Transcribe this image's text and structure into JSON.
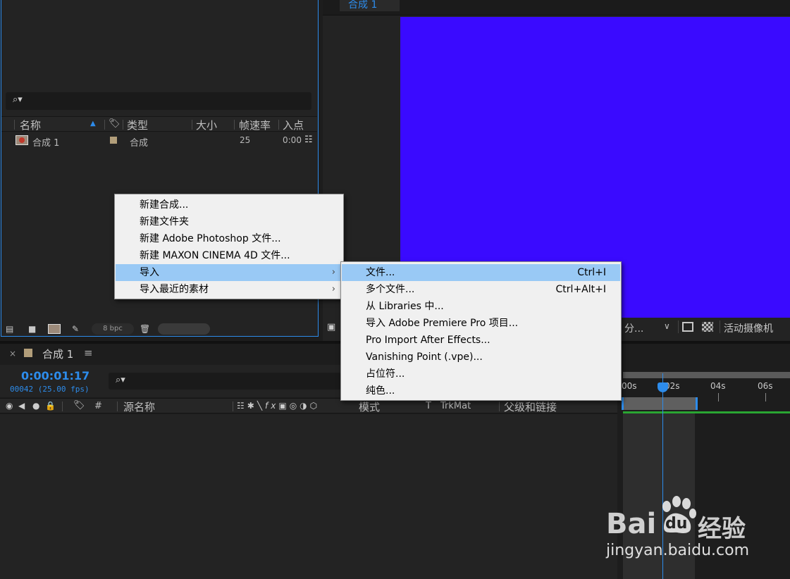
{
  "project_panel": {
    "columns": [
      "名称",
      "类型",
      "大小",
      "帧速率",
      "入点"
    ],
    "items": [
      {
        "name": "合成 1",
        "type": "合成",
        "fps": "25",
        "in_point": "0:00"
      }
    ],
    "bpc": "8 bpc"
  },
  "viewer": {
    "tab_label": "合成 1",
    "canvas_color": "#3a0aff",
    "resolution_label": "分...",
    "camera_label": "活动摄像机"
  },
  "context_menu": {
    "items": [
      {
        "label": "新建合成..."
      },
      {
        "label": "新建文件夹"
      },
      {
        "label": "新建 Adobe Photoshop 文件..."
      },
      {
        "label": "新建 MAXON CINEMA 4D 文件..."
      },
      {
        "label": "导入",
        "submenu": true,
        "highlighted": true
      },
      {
        "label": "导入最近的素材",
        "submenu": true
      }
    ]
  },
  "import_submenu": {
    "items": [
      {
        "label": "文件...",
        "shortcut": "Ctrl+I",
        "highlighted": true
      },
      {
        "label": "多个文件...",
        "shortcut": "Ctrl+Alt+I"
      },
      {
        "label": "从 Libraries 中...",
        "shortcut": ""
      },
      {
        "label": "导入 Adobe Premiere Pro 项目...",
        "shortcut": ""
      },
      {
        "label": "Pro Import After Effects...",
        "shortcut": ""
      },
      {
        "label": "Vanishing Point (.vpe)...",
        "shortcut": ""
      },
      {
        "label": "占位符...",
        "shortcut": ""
      },
      {
        "label": "纯色...",
        "shortcut": ""
      }
    ]
  },
  "timeline": {
    "close_glyph": "×",
    "comp_name": "合成 1",
    "menu_glyph": "≡",
    "timecode": "0:00:01:17",
    "frame_info": "00042 (25.00 fps)",
    "layer_columns": {
      "hash": "#",
      "source_name": "源名称",
      "mode": "模式",
      "t": "T",
      "trkmat": "TrkMat",
      "parent": "父级和链接"
    },
    "ruler_labels": [
      "00s",
      "02s",
      "04s",
      "06s"
    ],
    "time_fraction": 0.08
  },
  "watermark": {
    "brand": "Bai",
    "brand2": "du",
    "suffix": "经验",
    "url": "jingyan.baidu.com"
  },
  "colors": {
    "accent": "#2d8ceb",
    "menu_highlight": "#99c9f5",
    "canvas": "#3a0aff",
    "label_tan": "#b29e7a"
  }
}
